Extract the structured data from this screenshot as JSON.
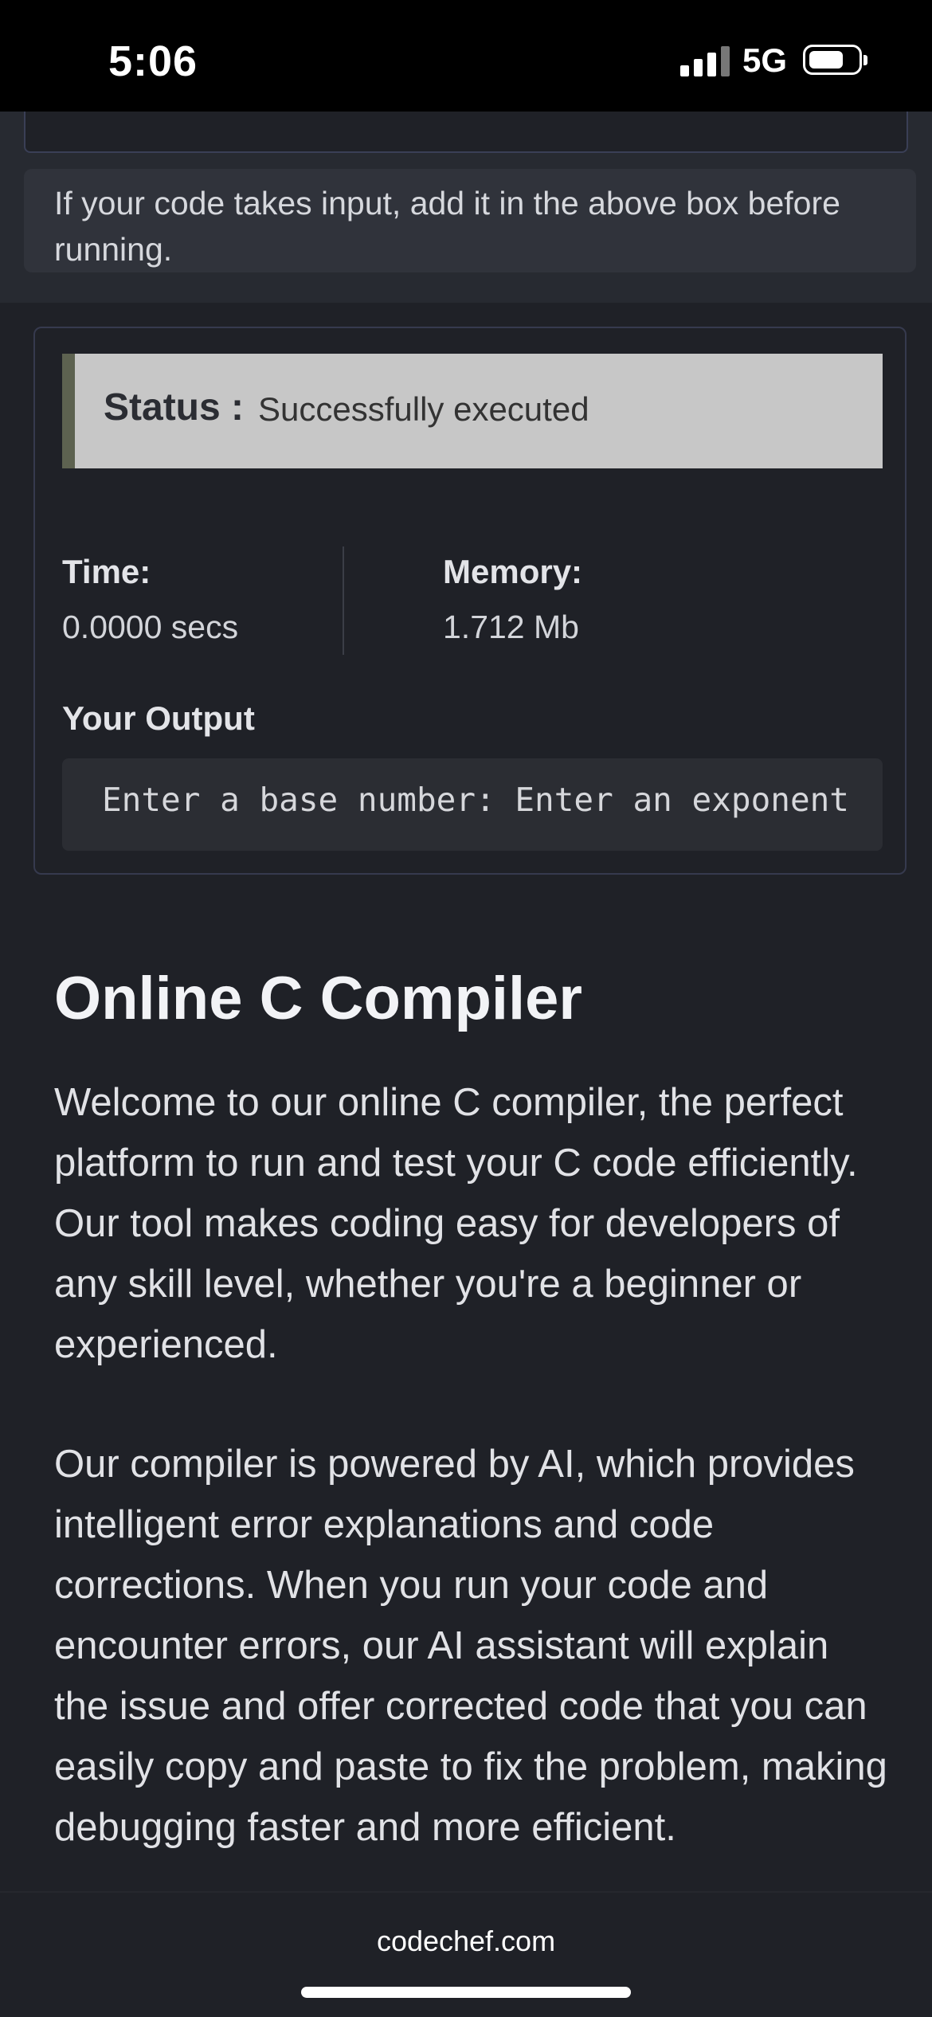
{
  "status_bar": {
    "time": "5:06",
    "network": "5G",
    "icons": [
      "signal-icon",
      "battery-icon"
    ]
  },
  "input_hint": "If your code takes input, add it in the above box before running.",
  "result": {
    "status_label": "Status :",
    "status_value": "Successfully executed",
    "time_label": "Time:",
    "time_value": "0.0000 secs",
    "memory_label": "Memory:",
    "memory_value": "1.712 Mb",
    "output_label": "Your Output",
    "output_text": "Enter a base number: Enter an exponent"
  },
  "article": {
    "title": "Online C Compiler",
    "paragraph1": "Welcome to our online C compiler, the perfect platform to run and test your C code efficiently. Our tool makes coding easy for developers of any skill level, whether you're a beginner or experienced.",
    "paragraph2": "Our compiler is powered by AI, which provides intelligent error explanations and code corrections. When you run your code and encounter errors, our AI assistant will explain the issue and offer corrected code that you can easily copy and paste to fix the problem, making debugging faster and more efficient."
  },
  "browser": {
    "url": "codechef.com"
  },
  "colors": {
    "page_bg": "#1f2127",
    "status_box_bg": "#c7c7c7",
    "status_accent": "#5d6250",
    "panel_border": "#363a4e"
  }
}
